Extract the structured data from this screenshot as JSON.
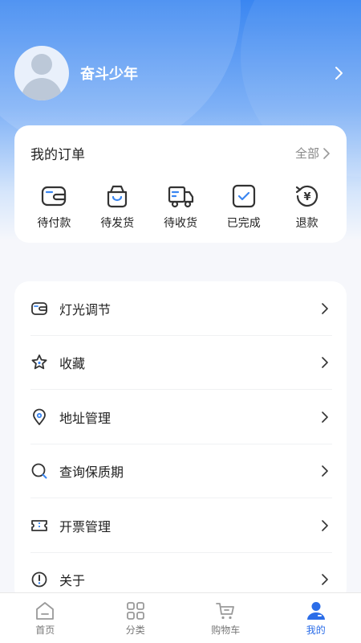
{
  "profile": {
    "username": "奋斗少年"
  },
  "orders": {
    "title": "我的订单",
    "all_label": "全部",
    "items": [
      {
        "label": "待付款",
        "icon": "wallet-icon"
      },
      {
        "label": "待发货",
        "icon": "shopping-bag-icon"
      },
      {
        "label": "待收货",
        "icon": "delivery-truck-icon"
      },
      {
        "label": "已完成",
        "icon": "check-box-icon"
      },
      {
        "label": "退款",
        "icon": "refund-yen-icon"
      }
    ]
  },
  "menu": {
    "items": [
      {
        "label": "灯光调节",
        "icon": "wallet-icon"
      },
      {
        "label": "收藏",
        "icon": "star-icon"
      },
      {
        "label": "地址管理",
        "icon": "location-pin-icon"
      },
      {
        "label": "查询保质期",
        "icon": "search-icon"
      },
      {
        "label": "开票管理",
        "icon": "ticket-icon"
      },
      {
        "label": "关于",
        "icon": "info-icon"
      }
    ]
  },
  "tabbar": {
    "items": [
      {
        "label": "首页",
        "icon": "home-icon",
        "active": false
      },
      {
        "label": "分类",
        "icon": "grid-icon",
        "active": false
      },
      {
        "label": "购物车",
        "icon": "cart-icon",
        "active": false
      },
      {
        "label": "我的",
        "icon": "user-icon",
        "active": true
      }
    ]
  },
  "colors": {
    "accent": "#2b6de8",
    "header_gradient_top": "#3a86f1",
    "background": "#f6f7fb"
  }
}
